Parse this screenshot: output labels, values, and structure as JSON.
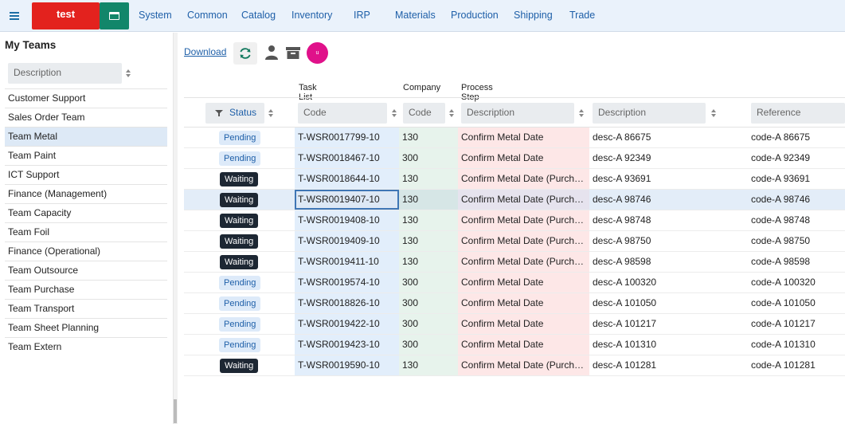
{
  "app": {
    "brand": "test",
    "nav": [
      "System",
      "Common",
      "Catalog",
      "Inventory",
      "IRP",
      "Materials",
      "Production",
      "Shipping",
      "Trade"
    ]
  },
  "sidebar": {
    "title": "My Teams",
    "filter_placeholder": "Description",
    "items": [
      "Customer Support",
      "Sales Order Team",
      "Team Metal",
      "Team Paint",
      "ICT Support",
      "Finance (Management)",
      "Team Capacity",
      "Team Foil",
      "Finance (Operational)",
      "Team Outsource",
      "Team Purchase",
      "Team Transport",
      "Team Sheet Planning",
      "Team Extern"
    ],
    "active_item": "Team Metal"
  },
  "toolbar": {
    "download_label": "Download",
    "avatar_initials": "u"
  },
  "table": {
    "groups": {
      "task_list": "Task List",
      "company": "Company",
      "process_step": "Process Step"
    },
    "filters": {
      "status": "Status",
      "code1": "Code",
      "code2": "Code",
      "description1": "Description",
      "description2": "Description",
      "reference": "Reference"
    },
    "rows": [
      {
        "status": "Pending",
        "task": "T-WSR0017799-10",
        "company": "130",
        "step": "Confirm Metal Date",
        "desc": "desc-A 86675",
        "ref": "code-A 86675"
      },
      {
        "status": "Pending",
        "task": "T-WSR0018467-10",
        "company": "300",
        "step": "Confirm Metal Date",
        "desc": "desc-A 92349",
        "ref": "code-A 92349"
      },
      {
        "status": "Waiting",
        "task": "T-WSR0018644-10",
        "company": "130",
        "step": "Confirm Metal Date (Purchase)",
        "desc": "desc-A 93691",
        "ref": "code-A 93691"
      },
      {
        "status": "Waiting",
        "task": "T-WSR0019407-10",
        "company": "130",
        "step": "Confirm Metal Date (Purchase)",
        "desc": "desc-A 98746",
        "ref": "code-A 98746"
      },
      {
        "status": "Waiting",
        "task": "T-WSR0019408-10",
        "company": "130",
        "step": "Confirm Metal Date (Purchase)",
        "desc": "desc-A 98748",
        "ref": "code-A 98748"
      },
      {
        "status": "Waiting",
        "task": "T-WSR0019409-10",
        "company": "130",
        "step": "Confirm Metal Date (Purchase)",
        "desc": "desc-A 98750",
        "ref": "code-A 98750"
      },
      {
        "status": "Waiting",
        "task": "T-WSR0019411-10",
        "company": "130",
        "step": "Confirm Metal Date (Purchase)",
        "desc": "desc-A 98598",
        "ref": "code-A 98598"
      },
      {
        "status": "Pending",
        "task": "T-WSR0019574-10",
        "company": "300",
        "step": "Confirm Metal Date",
        "desc": "desc-A 100320",
        "ref": "code-A 100320"
      },
      {
        "status": "Pending",
        "task": "T-WSR0018826-10",
        "company": "300",
        "step": "Confirm Metal Date",
        "desc": "desc-A 101050",
        "ref": "code-A 101050"
      },
      {
        "status": "Pending",
        "task": "T-WSR0019422-10",
        "company": "300",
        "step": "Confirm Metal Date",
        "desc": "desc-A 101217",
        "ref": "code-A 101217"
      },
      {
        "status": "Pending",
        "task": "T-WSR0019423-10",
        "company": "300",
        "step": "Confirm Metal Date",
        "desc": "desc-A 101310",
        "ref": "code-A 101310"
      },
      {
        "status": "Waiting",
        "task": "T-WSR0019590-10",
        "company": "130",
        "step": "Confirm Metal Date (Purchase)",
        "desc": "desc-A 101281",
        "ref": "code-A 101281"
      }
    ],
    "selected_row": 3
  },
  "colors": {
    "brand": "#e3221e",
    "app_button": "#12866a",
    "nav_text": "#1e5fa8",
    "avatar": "#e0118a",
    "waiting_badge": "#1d2733",
    "pending_badge": "#ddeaf9"
  }
}
